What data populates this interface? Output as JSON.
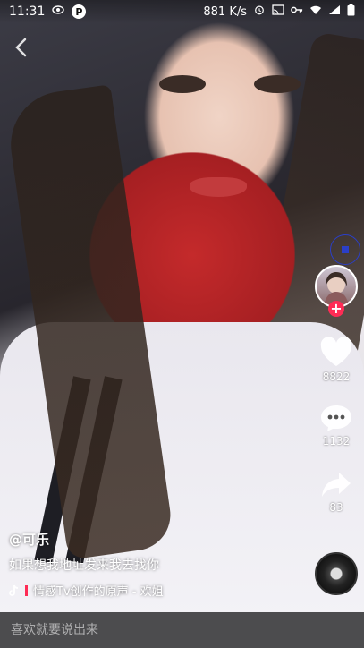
{
  "status_bar": {
    "time": "11:31",
    "network_speed": "881 K/s",
    "app_badge": "P",
    "icons": [
      "visibility-icon",
      "p-badge",
      "alarm-icon",
      "cast-icon",
      "key-icon",
      "wifi-icon",
      "signal-icon",
      "battery-icon"
    ]
  },
  "nav": {
    "back_icon": "chevron-left-icon"
  },
  "video": {
    "username": "@可乐",
    "caption": "如果想我地址发来我去找你",
    "music_text": "情感Tv创作的原声 - 欢姐"
  },
  "actions": {
    "like_count": "8822",
    "comment_count": "1132",
    "share_count": "83"
  },
  "comment": {
    "placeholder": "喜欢就要说出来"
  },
  "colors": {
    "accent": "#fe2c55",
    "record_indicator": "#2b3fc7"
  }
}
